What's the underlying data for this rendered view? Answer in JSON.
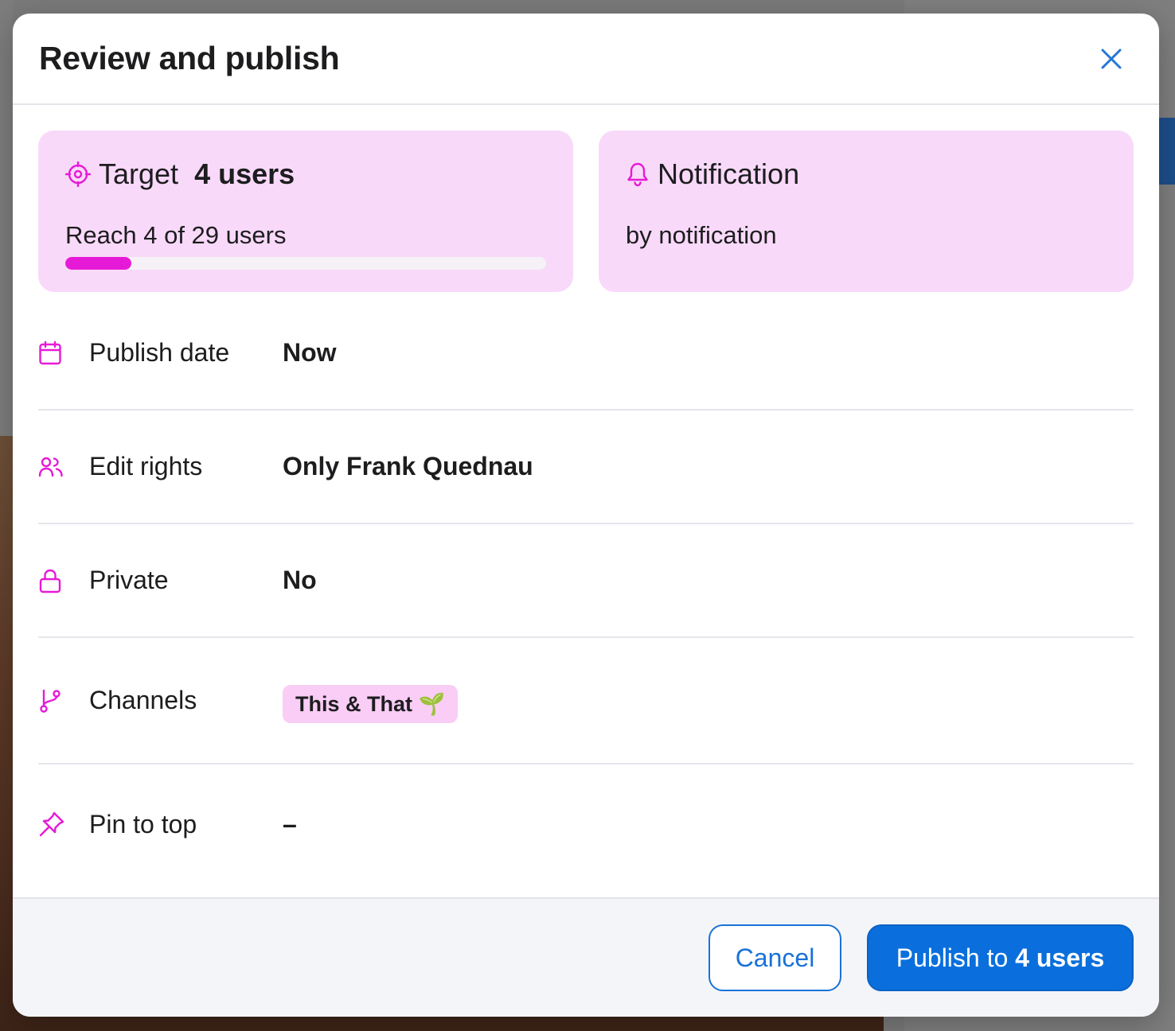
{
  "modal": {
    "title": "Review and publish",
    "close_icon": "close-icon"
  },
  "target_card": {
    "icon": "target-icon",
    "prefix": "Target",
    "strong": "4 users",
    "reach_text": "Reach 4 of 29 users",
    "reach_fraction": 0.138,
    "accent": "#e61ad6"
  },
  "notification_card": {
    "icon": "bell-icon",
    "title": "Notification",
    "sub": "by notification"
  },
  "rows": [
    {
      "icon": "calendar-icon",
      "label": "Publish date",
      "value": "Now"
    },
    {
      "icon": "users-icon",
      "label": "Edit rights",
      "value": "Only Frank Quednau"
    },
    {
      "icon": "lock-icon",
      "label": "Private",
      "value": "No"
    },
    {
      "icon": "branch-icon",
      "label": "Channels",
      "chip": "This & That 🌱"
    },
    {
      "icon": "pin-icon",
      "label": "Pin to top",
      "value": "–"
    }
  ],
  "footer": {
    "cancel_label": "Cancel",
    "publish_prefix": "Publish to ",
    "publish_strong": "4 users"
  },
  "colors": {
    "accent_magenta": "#e61ad6",
    "card_bg": "#f9d9f9",
    "primary_blue": "#0a6fdc"
  }
}
